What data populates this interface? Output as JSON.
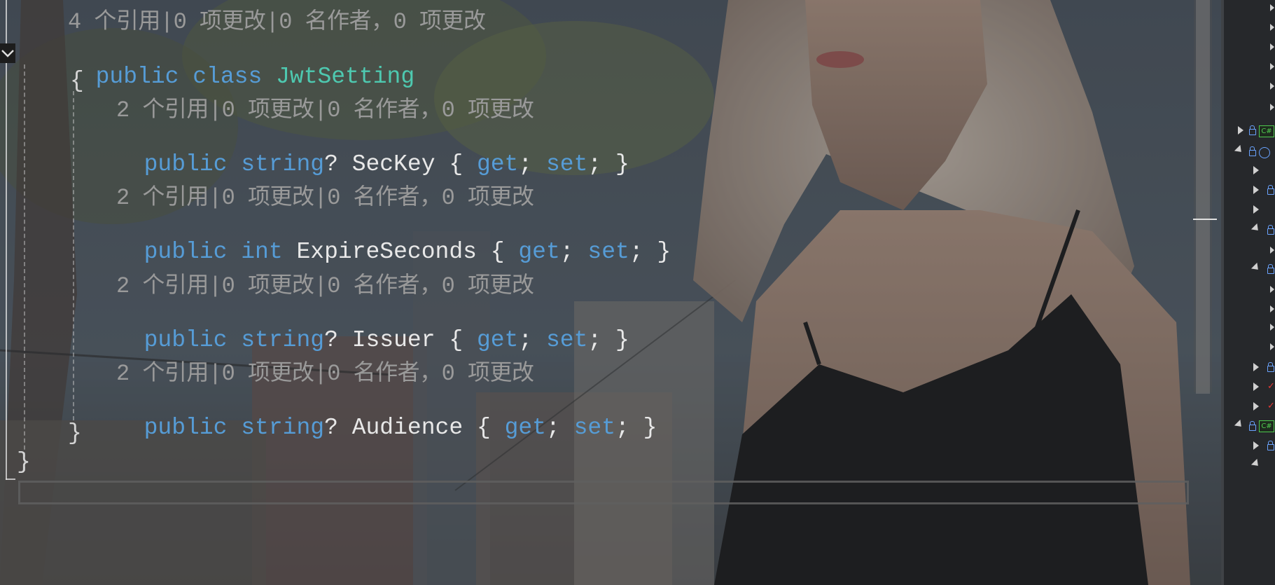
{
  "editor": {
    "class_lens": "4 个引用|0 项更改|0 名作者，0 项更改",
    "class_decl": {
      "kw1": "public",
      "kw2": "class",
      "name": "JwtSetting"
    },
    "open_brace": "{",
    "close_brace": "}",
    "outer_close_brace": "}",
    "properties": [
      {
        "lens": "2 个引用|0 项更改|0 名作者，0 项更改",
        "kw": "public",
        "type": "string",
        "suffix": "?",
        "name": "SecKey",
        "get": "get",
        "set": "set"
      },
      {
        "lens": "2 个引用|0 项更改|0 名作者，0 项更改",
        "kw": "public",
        "type": "int",
        "suffix": "",
        "name": "ExpireSeconds",
        "get": "get",
        "set": "set"
      },
      {
        "lens": "2 个引用|0 项更改|0 名作者，0 项更改",
        "kw": "public",
        "type": "string",
        "suffix": "?",
        "name": "Issuer",
        "get": "get",
        "set": "set"
      },
      {
        "lens": "2 个引用|0 项更改|0 名作者，0 项更改",
        "kw": "public",
        "type": "string",
        "suffix": "?",
        "name": "Audience",
        "get": "get",
        "set": "set"
      }
    ]
  },
  "solution_panel": {
    "cs_badge": "C#"
  },
  "colors": {
    "keyword": "#569cd6",
    "type_name": "#4ec9b0",
    "lens_text": "#9a9a9a",
    "identifier": "#e8e8e8"
  }
}
